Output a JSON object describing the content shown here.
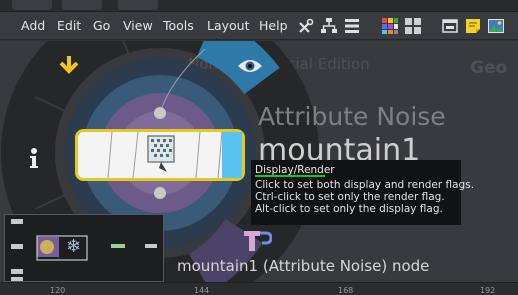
{
  "menubar": {
    "items": [
      "Add",
      "Edit",
      "Go",
      "View",
      "Tools",
      "Layout",
      "Help"
    ]
  },
  "canvas": {
    "watermark": "Non-Commercial Edition",
    "context_label": "Geo",
    "node_type": "Attribute Noise",
    "node_name": "mountain1",
    "node_footer": "mountain1 (Attribute Noise) node"
  },
  "tooltip": {
    "title": "Display/Render",
    "lines": [
      "Click to set both display and render flags.",
      "Ctrl-click to set only the render flag.",
      "Alt-click to set only the display flag."
    ]
  },
  "ruler": {
    "ticks": [
      "120",
      "144",
      "168",
      "192"
    ]
  },
  "colors": {
    "accent_yellow": "#f2c417",
    "display_flag_blue": "#57c4f2",
    "node_border": "#e8c81e",
    "tooltip_underline": "#19c22a"
  }
}
